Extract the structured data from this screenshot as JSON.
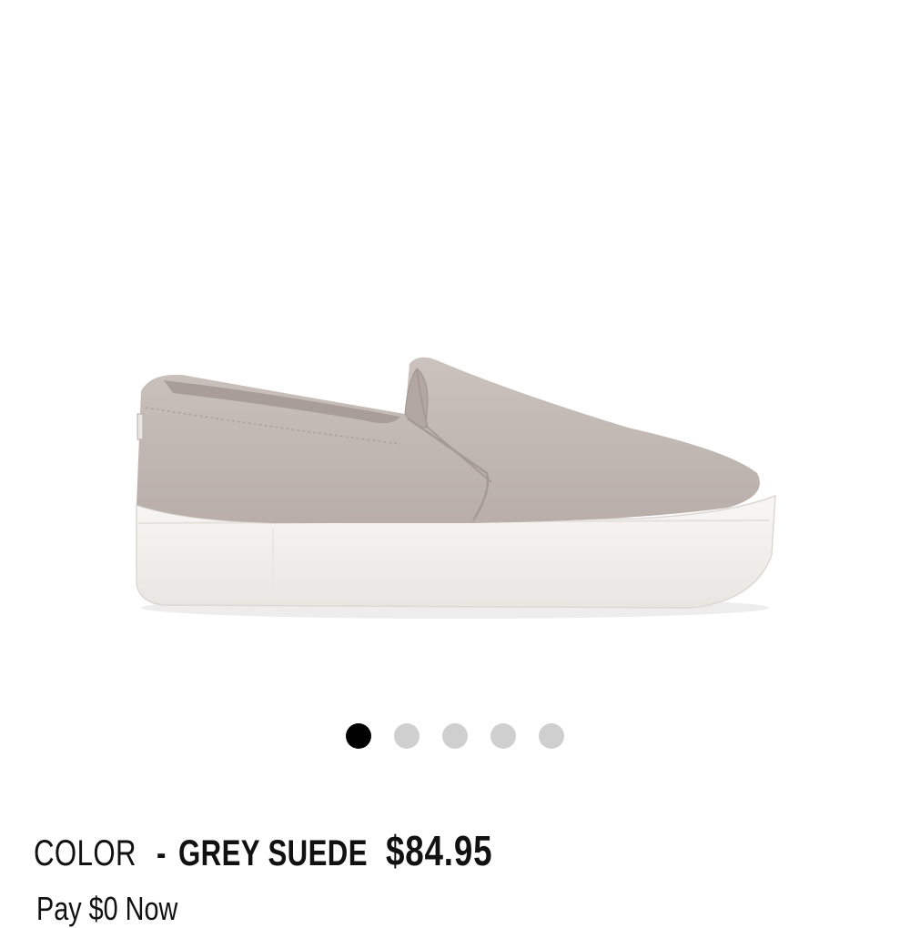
{
  "product": {
    "image_alt": "grey suede platform slip-on sneaker",
    "color_label": "COLOR",
    "color_separator": "-",
    "color_value": "GREY SUEDE",
    "price": "$84.95",
    "promo": "Pay $0 Now"
  },
  "carousel": {
    "total": 5,
    "active_index": 0
  },
  "colors": {
    "suede": "#c3b9b4",
    "sole": "#f3f1ee",
    "dot_active": "#000000",
    "dot_inactive": "#cfcfcf"
  }
}
